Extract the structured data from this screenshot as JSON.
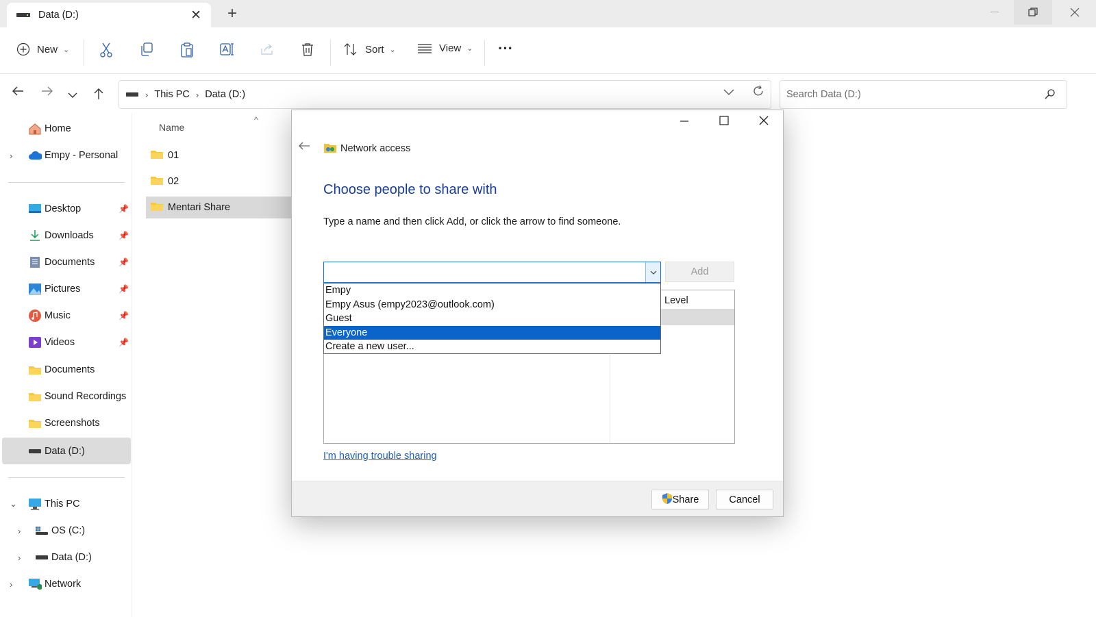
{
  "window": {
    "tab_title": "Data (D:)",
    "new_tab_glyph": "+",
    "close_tab_glyph": "✕"
  },
  "toolbar": {
    "new_label": "New",
    "sort_label": "Sort",
    "view_label": "View",
    "more_glyph": "···",
    "icons": [
      "cut-icon",
      "copy-icon",
      "paste-icon",
      "rename-icon",
      "share-icon",
      "delete-icon"
    ]
  },
  "address": {
    "crumbs": [
      "This PC",
      "Data (D:)"
    ],
    "separator": "›"
  },
  "search": {
    "placeholder": "Search Data (D:)"
  },
  "sidebar": {
    "home": "Home",
    "onedrive": "Empy - Personal",
    "quick_access": [
      {
        "label": "Desktop",
        "icon": "desktop-icon",
        "pinned": true
      },
      {
        "label": "Downloads",
        "icon": "download-icon",
        "pinned": true
      },
      {
        "label": "Documents",
        "icon": "documents-icon",
        "pinned": true
      },
      {
        "label": "Pictures",
        "icon": "pictures-icon",
        "pinned": true
      },
      {
        "label": "Music",
        "icon": "music-icon",
        "pinned": true
      },
      {
        "label": "Videos",
        "icon": "videos-icon",
        "pinned": true
      },
      {
        "label": "Documents",
        "icon": "folder-icon",
        "pinned": false
      },
      {
        "label": "Sound Recordings",
        "icon": "folder-icon",
        "pinned": false
      },
      {
        "label": "Screenshots",
        "icon": "folder-icon",
        "pinned": false
      },
      {
        "label": "Data (D:)",
        "icon": "drive-icon",
        "pinned": false
      }
    ],
    "this_pc": "This PC",
    "drives": [
      "OS (C:)",
      "Data (D:)"
    ],
    "network": "Network"
  },
  "file_list": {
    "column_name": "Name",
    "items": [
      "01",
      "02",
      "Mentari Share"
    ],
    "selected_index": 2
  },
  "dialog": {
    "header": "Network access",
    "title": "Choose people to share with",
    "instruction": "Type a name and then click Add, or click the arrow to find someone.",
    "input_value": "",
    "add_label": "Add",
    "dropdown_options": [
      "Empy",
      "Empy Asus (empy2023@outlook.com)",
      "Guest",
      "Everyone",
      "Create a new user..."
    ],
    "highlighted_option": "Everyone",
    "column_level": "Level",
    "trouble_link": "I'm having trouble sharing",
    "share_label": "Share",
    "cancel_label": "Cancel"
  },
  "colors": {
    "accent": "#0a64c9",
    "title_blue": "#1a3d9a",
    "link": "#1a5fb4"
  }
}
